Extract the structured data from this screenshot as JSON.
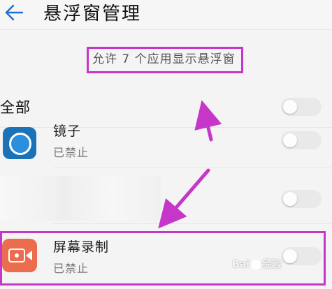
{
  "header": {
    "title": "悬浮窗管理",
    "back_icon": "back-arrow-icon"
  },
  "summary": {
    "text": "允许 7 个应用显示悬浮窗"
  },
  "all_row": {
    "label": "全部",
    "toggle_on": false
  },
  "apps": [
    {
      "name": "镜子",
      "status": "已禁止",
      "icon": "mirror-app-icon",
      "toggle_on": false
    },
    {
      "name": "",
      "status": "",
      "icon": "",
      "toggle_on": false
    },
    {
      "name": "屏幕录制",
      "status": "已禁止",
      "icon": "screen-record-app-icon",
      "toggle_on": false
    }
  ],
  "annotation": {
    "highlight_color": "#c636c8",
    "arrow_color": "#c636c8"
  },
  "watermark": {
    "text_left": "Bai",
    "text_right": "经验"
  }
}
